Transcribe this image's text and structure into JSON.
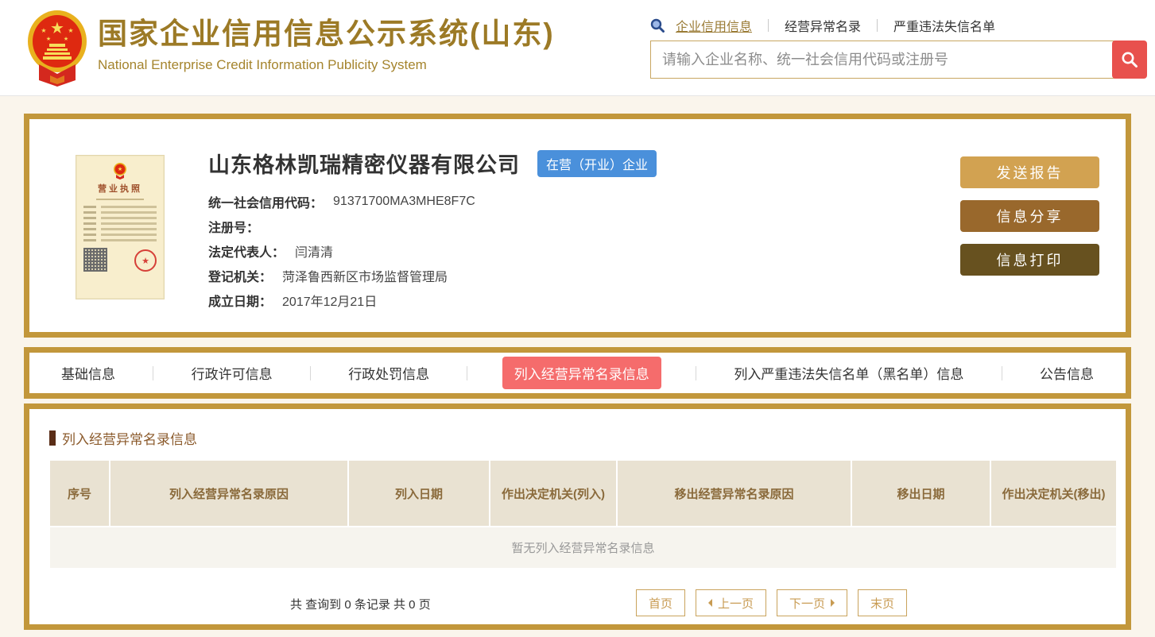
{
  "colors": {
    "page_background": "#FAF5EC",
    "card_border_gold": "#C2973B",
    "title_gold": "#9C7A26",
    "active_link_gold": "#9A7B35",
    "search_button_red": "#E8514D",
    "status_badge_blue": "#4A90DB",
    "button_report_gold": "#D2A251",
    "button_share_brown": "#99682C",
    "button_print_dark_brown": "#67511F",
    "active_tab_red": "#F56C6C",
    "table_header_bg": "#E9E2D2",
    "table_header_text": "#8A6A3B",
    "section_bar_maroon": "#5A2D17",
    "pagination_gold": "#C89B52"
  },
  "header": {
    "title": "国家企业信用信息公示系统(山东)",
    "subtitle": "National Enterprise Credit Information Publicity System",
    "nav": {
      "links": [
        {
          "label": "企业信用信息",
          "active": true
        },
        {
          "label": "经营异常名录",
          "active": false
        },
        {
          "label": "严重违法失信名单",
          "active": false
        }
      ]
    },
    "search": {
      "placeholder": "请输入企业名称、统一社会信用代码或注册号"
    }
  },
  "company": {
    "name": "山东格林凯瑞精密仪器有限公司",
    "status_badge": "在营（开业）企业",
    "license_title": "营业执照",
    "fields": [
      {
        "label": "统一社会信用代码：",
        "value": "91371700MA3MHE8F7C"
      },
      {
        "label": "注册号：",
        "value": ""
      },
      {
        "label": "法定代表人：",
        "value": "闫清清"
      },
      {
        "label": "登记机关：",
        "value": "菏泽鲁西新区市场监督管理局"
      },
      {
        "label": "成立日期：",
        "value": "2017年12月21日"
      }
    ],
    "actions": [
      {
        "label": "发送报告"
      },
      {
        "label": "信息分享"
      },
      {
        "label": "信息打印"
      }
    ]
  },
  "tabs": [
    {
      "label": "基础信息",
      "active": false
    },
    {
      "label": "行政许可信息",
      "active": false
    },
    {
      "label": "行政处罚信息",
      "active": false
    },
    {
      "label": "列入经营异常名录信息",
      "active": true
    },
    {
      "label": "列入严重违法失信名单（黑名单）信息",
      "active": false
    },
    {
      "label": "公告信息",
      "active": false
    }
  ],
  "section": {
    "title": "列入经营异常名录信息",
    "table": {
      "headers": [
        "序号",
        "列入经营异常名录原因",
        "列入日期",
        "作出决定机关(列入)",
        "移出经营异常名录原因",
        "移出日期",
        "作出决定机关(移出)"
      ],
      "empty_text": "暂无列入经营异常名录信息"
    },
    "pagination": {
      "summary": "共 查询到 0 条记录 共 0 页",
      "first": "首页",
      "prev": "上一页",
      "next": "下一页",
      "last": "末页"
    }
  }
}
